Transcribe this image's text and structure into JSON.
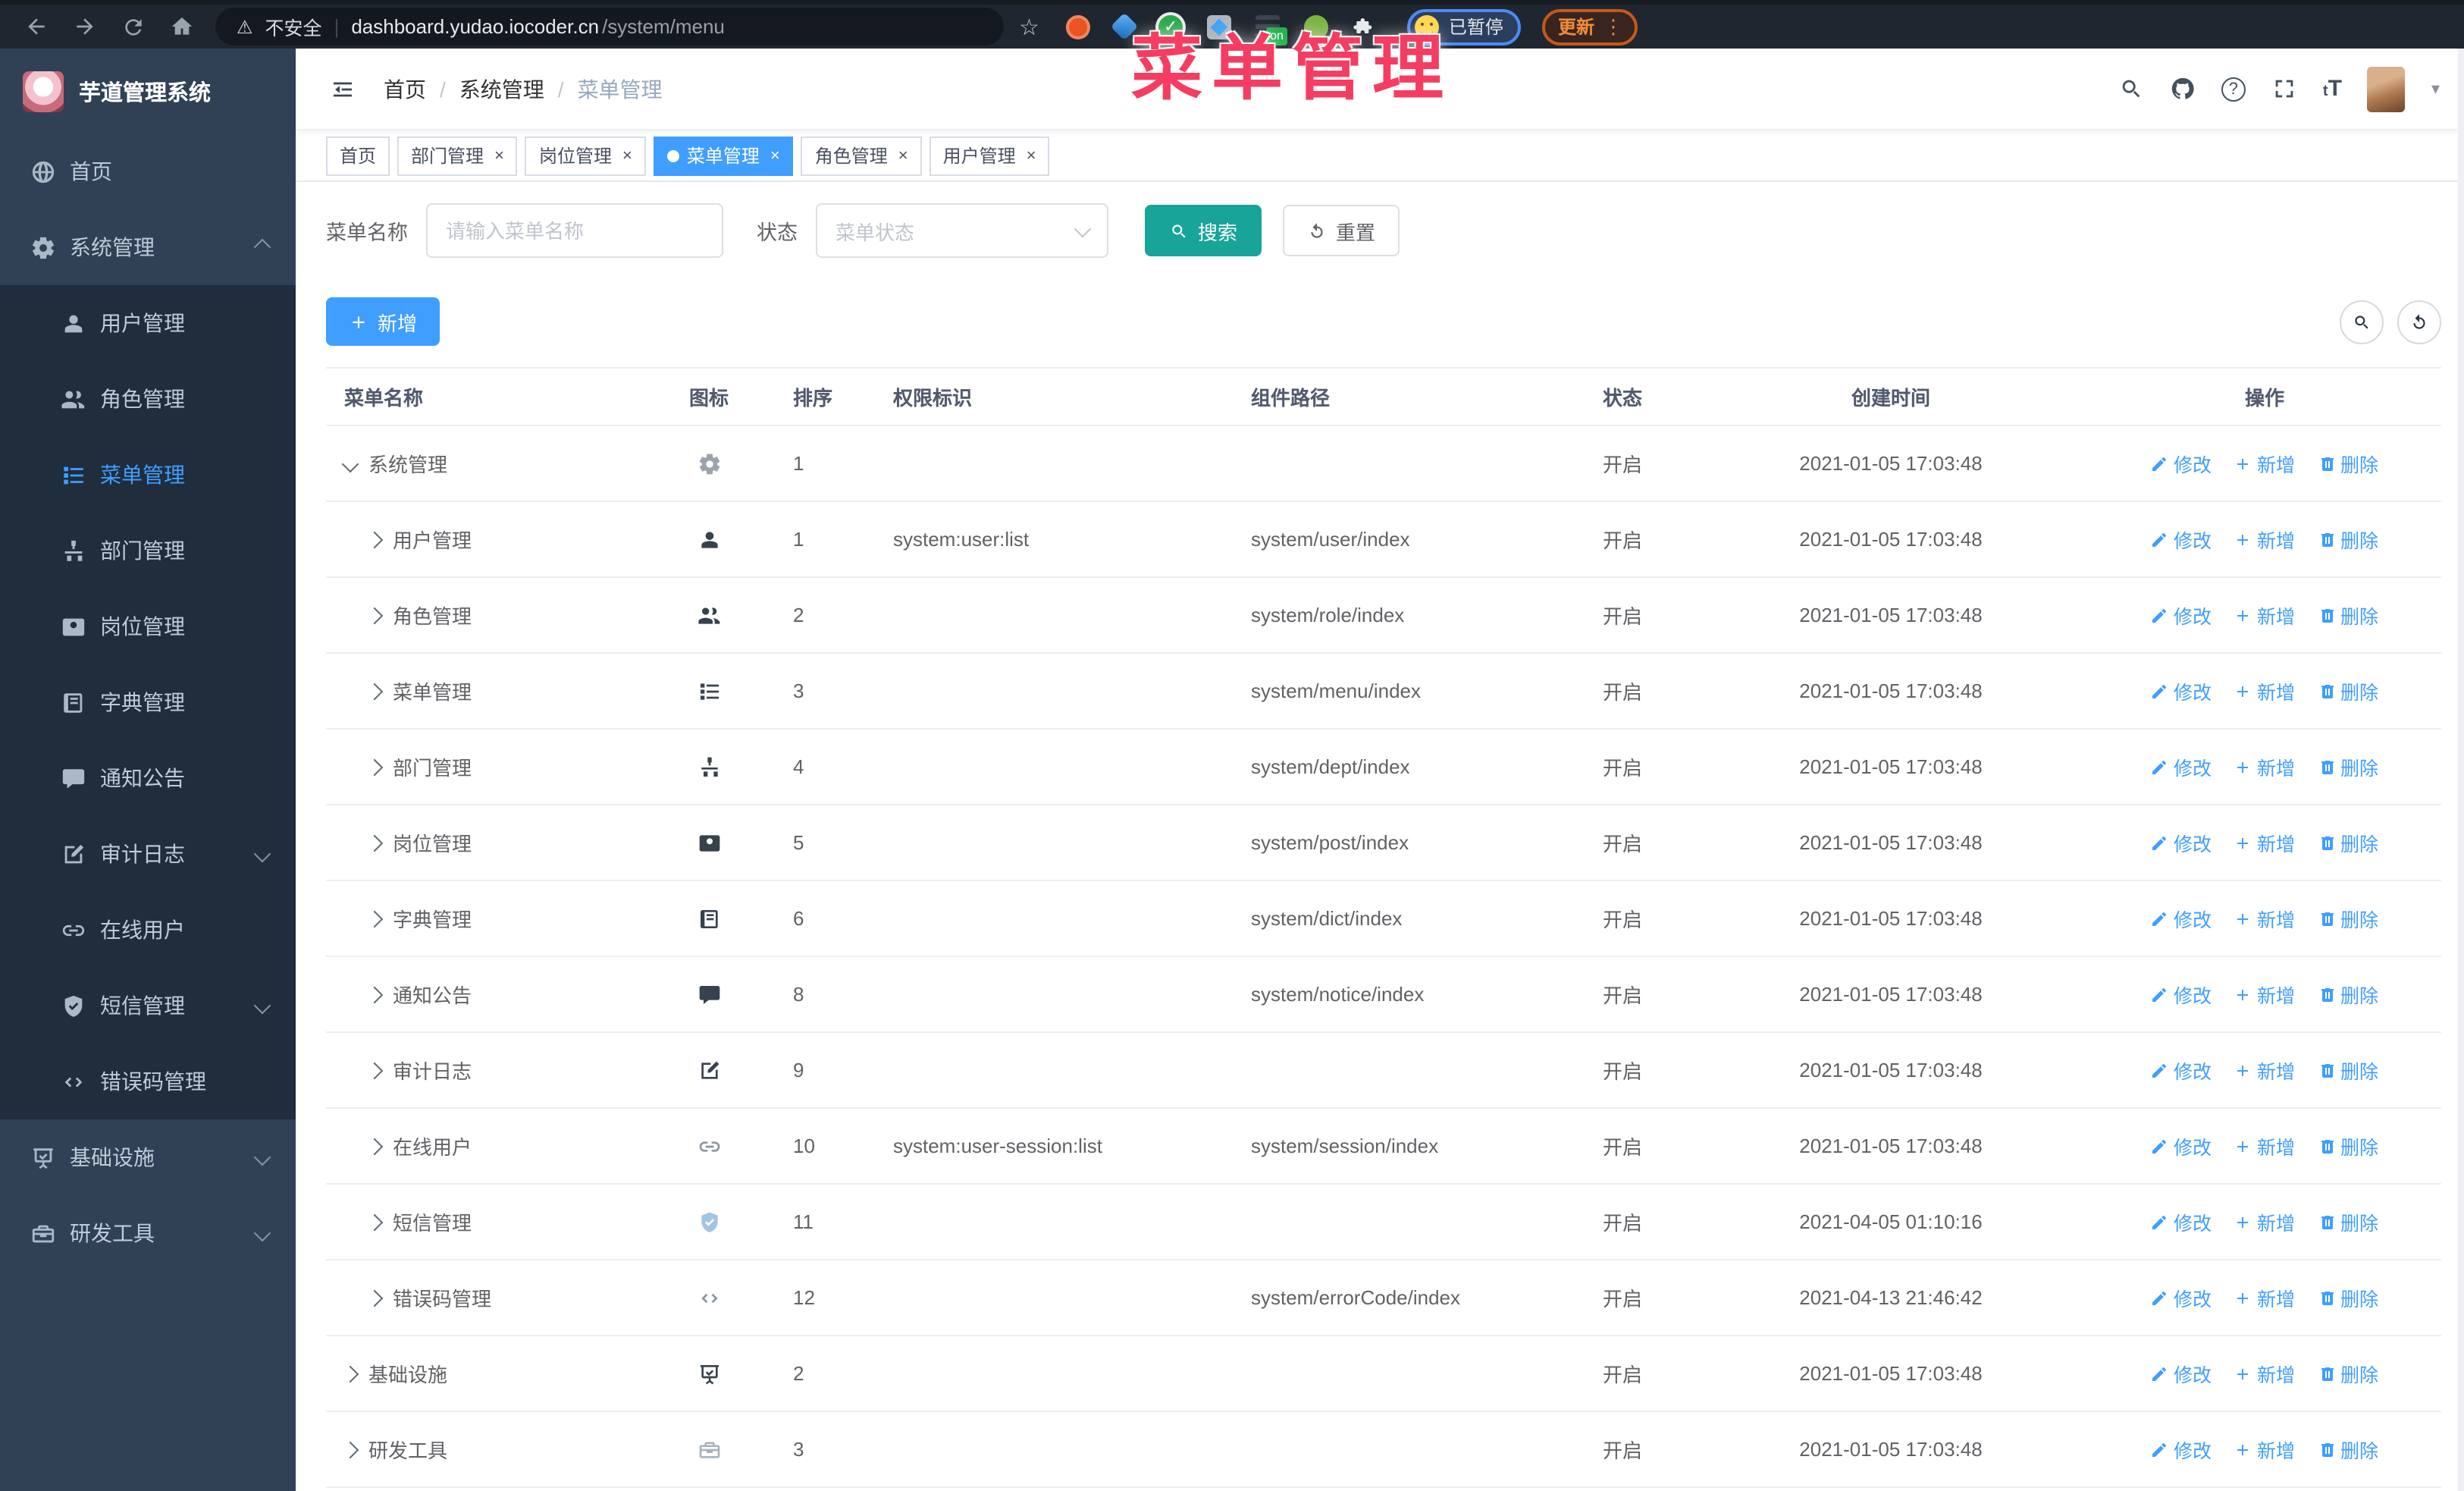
{
  "browser": {
    "security": "不安全",
    "url_domain": "dashboard.yudao.iocoder.cn",
    "url_path": "/system/menu",
    "ext_on_badge": "on",
    "paused_badge": "已暂停",
    "update_label": "更新"
  },
  "overlay": {
    "title": "菜单管理"
  },
  "colors": {
    "accent": "#409eff",
    "search_button": "#19a49a",
    "annotation_red": "#f53d62",
    "sidebar_bg": "#304156",
    "submenu_bg": "#1f2d3d"
  },
  "sidebar": {
    "logo_title": "芋道管理系统",
    "items": [
      {
        "label": "首页",
        "icon": "globe",
        "level": 0,
        "active": false,
        "chevron": null
      },
      {
        "label": "系统管理",
        "icon": "gear",
        "level": 0,
        "active": false,
        "chevron": "up"
      },
      {
        "label": "用户管理",
        "icon": "user",
        "level": 1,
        "active": false,
        "chevron": null
      },
      {
        "label": "角色管理",
        "icon": "users",
        "level": 1,
        "active": false,
        "chevron": null
      },
      {
        "label": "菜单管理",
        "icon": "tree",
        "level": 1,
        "active": true,
        "chevron": null
      },
      {
        "label": "部门管理",
        "icon": "org",
        "level": 1,
        "active": false,
        "chevron": null
      },
      {
        "label": "岗位管理",
        "icon": "badge",
        "level": 1,
        "active": false,
        "chevron": null
      },
      {
        "label": "字典管理",
        "icon": "book",
        "level": 1,
        "active": false,
        "chevron": null
      },
      {
        "label": "通知公告",
        "icon": "megaphone",
        "level": 1,
        "active": false,
        "chevron": null
      },
      {
        "label": "审计日志",
        "icon": "editlog",
        "level": 1,
        "active": false,
        "chevron": "down"
      },
      {
        "label": "在线用户",
        "icon": "link",
        "level": 1,
        "active": false,
        "chevron": null
      },
      {
        "label": "短信管理",
        "icon": "shield",
        "level": 1,
        "active": false,
        "chevron": "down"
      },
      {
        "label": "错误码管理",
        "icon": "code",
        "level": 1,
        "active": false,
        "chevron": null
      },
      {
        "label": "基础设施",
        "icon": "monitor",
        "level": 0,
        "active": false,
        "chevron": "down"
      },
      {
        "label": "研发工具",
        "icon": "toolbox",
        "level": 0,
        "active": false,
        "chevron": "down"
      }
    ]
  },
  "header": {
    "breadcrumb": [
      {
        "label": "首页",
        "muted": false
      },
      {
        "label": "系统管理",
        "muted": false
      },
      {
        "label": "菜单管理",
        "muted": true
      }
    ]
  },
  "tabs": [
    {
      "label": "首页",
      "active": false,
      "closable": false
    },
    {
      "label": "部门管理",
      "active": false,
      "closable": true
    },
    {
      "label": "岗位管理",
      "active": false,
      "closable": true
    },
    {
      "label": "菜单管理",
      "active": true,
      "closable": true
    },
    {
      "label": "角色管理",
      "active": false,
      "closable": true
    },
    {
      "label": "用户管理",
      "active": false,
      "closable": true
    }
  ],
  "filters": {
    "name_label": "菜单名称",
    "name_placeholder": "请输入菜单名称",
    "status_label": "状态",
    "status_placeholder": "菜单状态",
    "search_label": "搜索",
    "reset_label": "重置"
  },
  "toolbar": {
    "add_label": "新增"
  },
  "table": {
    "headers": [
      "菜单名称",
      "图标",
      "排序",
      "权限标识",
      "组件路径",
      "状态",
      "创建时间",
      "操作"
    ],
    "row_actions": [
      {
        "label": "修改",
        "icon": "pen"
      },
      {
        "label": "新增",
        "icon": "plus"
      },
      {
        "label": "删除",
        "icon": "trash"
      }
    ],
    "rows": [
      {
        "name": "系统管理",
        "icon": "gear",
        "tone": "gear",
        "level": 0,
        "expanded": true,
        "order": "1",
        "perm": "",
        "path": "",
        "status": "开启",
        "time": "2021-01-05 17:03:48"
      },
      {
        "name": "用户管理",
        "icon": "user",
        "tone": "dark",
        "level": 1,
        "expanded": false,
        "order": "1",
        "perm": "system:user:list",
        "path": "system/user/index",
        "status": "开启",
        "time": "2021-01-05 17:03:48"
      },
      {
        "name": "角色管理",
        "icon": "users",
        "tone": "dark",
        "level": 1,
        "expanded": false,
        "order": "2",
        "perm": "",
        "path": "system/role/index",
        "status": "开启",
        "time": "2021-01-05 17:03:48"
      },
      {
        "name": "菜单管理",
        "icon": "tree",
        "tone": "dark",
        "level": 1,
        "expanded": false,
        "order": "3",
        "perm": "",
        "path": "system/menu/index",
        "status": "开启",
        "time": "2021-01-05 17:03:48"
      },
      {
        "name": "部门管理",
        "icon": "org",
        "tone": "dark",
        "level": 1,
        "expanded": false,
        "order": "4",
        "perm": "",
        "path": "system/dept/index",
        "status": "开启",
        "time": "2021-01-05 17:03:48"
      },
      {
        "name": "岗位管理",
        "icon": "badge",
        "tone": "dark",
        "level": 1,
        "expanded": false,
        "order": "5",
        "perm": "",
        "path": "system/post/index",
        "status": "开启",
        "time": "2021-01-05 17:03:48"
      },
      {
        "name": "字典管理",
        "icon": "book",
        "tone": "dark",
        "level": 1,
        "expanded": false,
        "order": "6",
        "perm": "",
        "path": "system/dict/index",
        "status": "开启",
        "time": "2021-01-05 17:03:48"
      },
      {
        "name": "通知公告",
        "icon": "megaphone",
        "tone": "dark",
        "level": 1,
        "expanded": false,
        "order": "8",
        "perm": "",
        "path": "system/notice/index",
        "status": "开启",
        "time": "2021-01-05 17:03:48"
      },
      {
        "name": "审计日志",
        "icon": "editlog",
        "tone": "dark",
        "level": 1,
        "expanded": false,
        "order": "9",
        "perm": "",
        "path": "",
        "status": "开启",
        "time": "2021-01-05 17:03:48"
      },
      {
        "name": "在线用户",
        "icon": "link",
        "tone": "mid",
        "level": 1,
        "expanded": false,
        "order": "10",
        "perm": "system:user-session:list",
        "path": "system/session/index",
        "status": "开启",
        "time": "2021-01-05 17:03:48"
      },
      {
        "name": "短信管理",
        "icon": "shield",
        "tone": "blue",
        "level": 1,
        "expanded": false,
        "order": "11",
        "perm": "",
        "path": "",
        "status": "开启",
        "time": "2021-04-05 01:10:16"
      },
      {
        "name": "错误码管理",
        "icon": "code",
        "tone": "mid",
        "level": 1,
        "expanded": false,
        "order": "12",
        "perm": "",
        "path": "system/errorCode/index",
        "status": "开启",
        "time": "2021-04-13 21:46:42"
      },
      {
        "name": "基础设施",
        "icon": "monitor",
        "tone": "dark",
        "level": 0,
        "expanded": false,
        "order": "2",
        "perm": "",
        "path": "",
        "status": "开启",
        "time": "2021-01-05 17:03:48"
      },
      {
        "name": "研发工具",
        "icon": "toolbox",
        "tone": "light",
        "level": 0,
        "expanded": false,
        "order": "3",
        "perm": "",
        "path": "",
        "status": "开启",
        "time": "2021-01-05 17:03:48"
      }
    ]
  }
}
